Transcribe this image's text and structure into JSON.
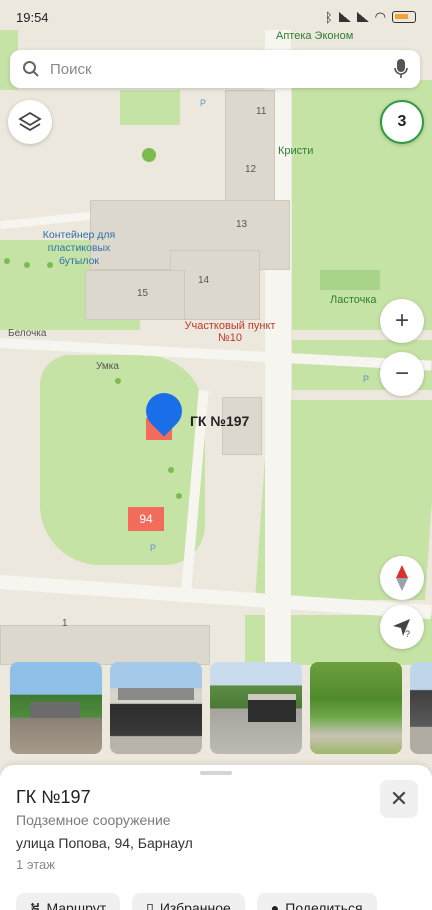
{
  "status_bar": {
    "time": "19:54"
  },
  "search": {
    "placeholder": "Поиск"
  },
  "traffic": {
    "level": "3"
  },
  "zoom": {
    "in": "+",
    "out": "−"
  },
  "compass": {
    "label": "N"
  },
  "location": {
    "label": "?"
  },
  "map_labels": {
    "apteka": "Аптека Эконом",
    "kristi": "Кристи",
    "lastochka": "Ласточка",
    "belochka": "Белочка",
    "umka": "Умка",
    "container": "Контейнер для пластиковых бутылок",
    "uchastkovy": "Участковый пункт №10",
    "gk197": "ГК №197",
    "b94": "94",
    "n11": "11",
    "n12": "12",
    "n13": "13",
    "n14": "14",
    "n15": "15",
    "n1": "1"
  },
  "place": {
    "title": "ГК №197",
    "subtitle": "Подземное сооружение",
    "address": "улица Попова, 94, Барнаул",
    "floor": "1 этаж"
  },
  "actions": [
    {
      "label": "Маршрут"
    },
    {
      "label": "Избранное"
    },
    {
      "label": "Поделиться"
    }
  ],
  "photos": [
    {
      "name": "photo-1"
    },
    {
      "name": "photo-2"
    },
    {
      "name": "photo-3"
    },
    {
      "name": "photo-4"
    },
    {
      "name": "photo-5"
    }
  ]
}
